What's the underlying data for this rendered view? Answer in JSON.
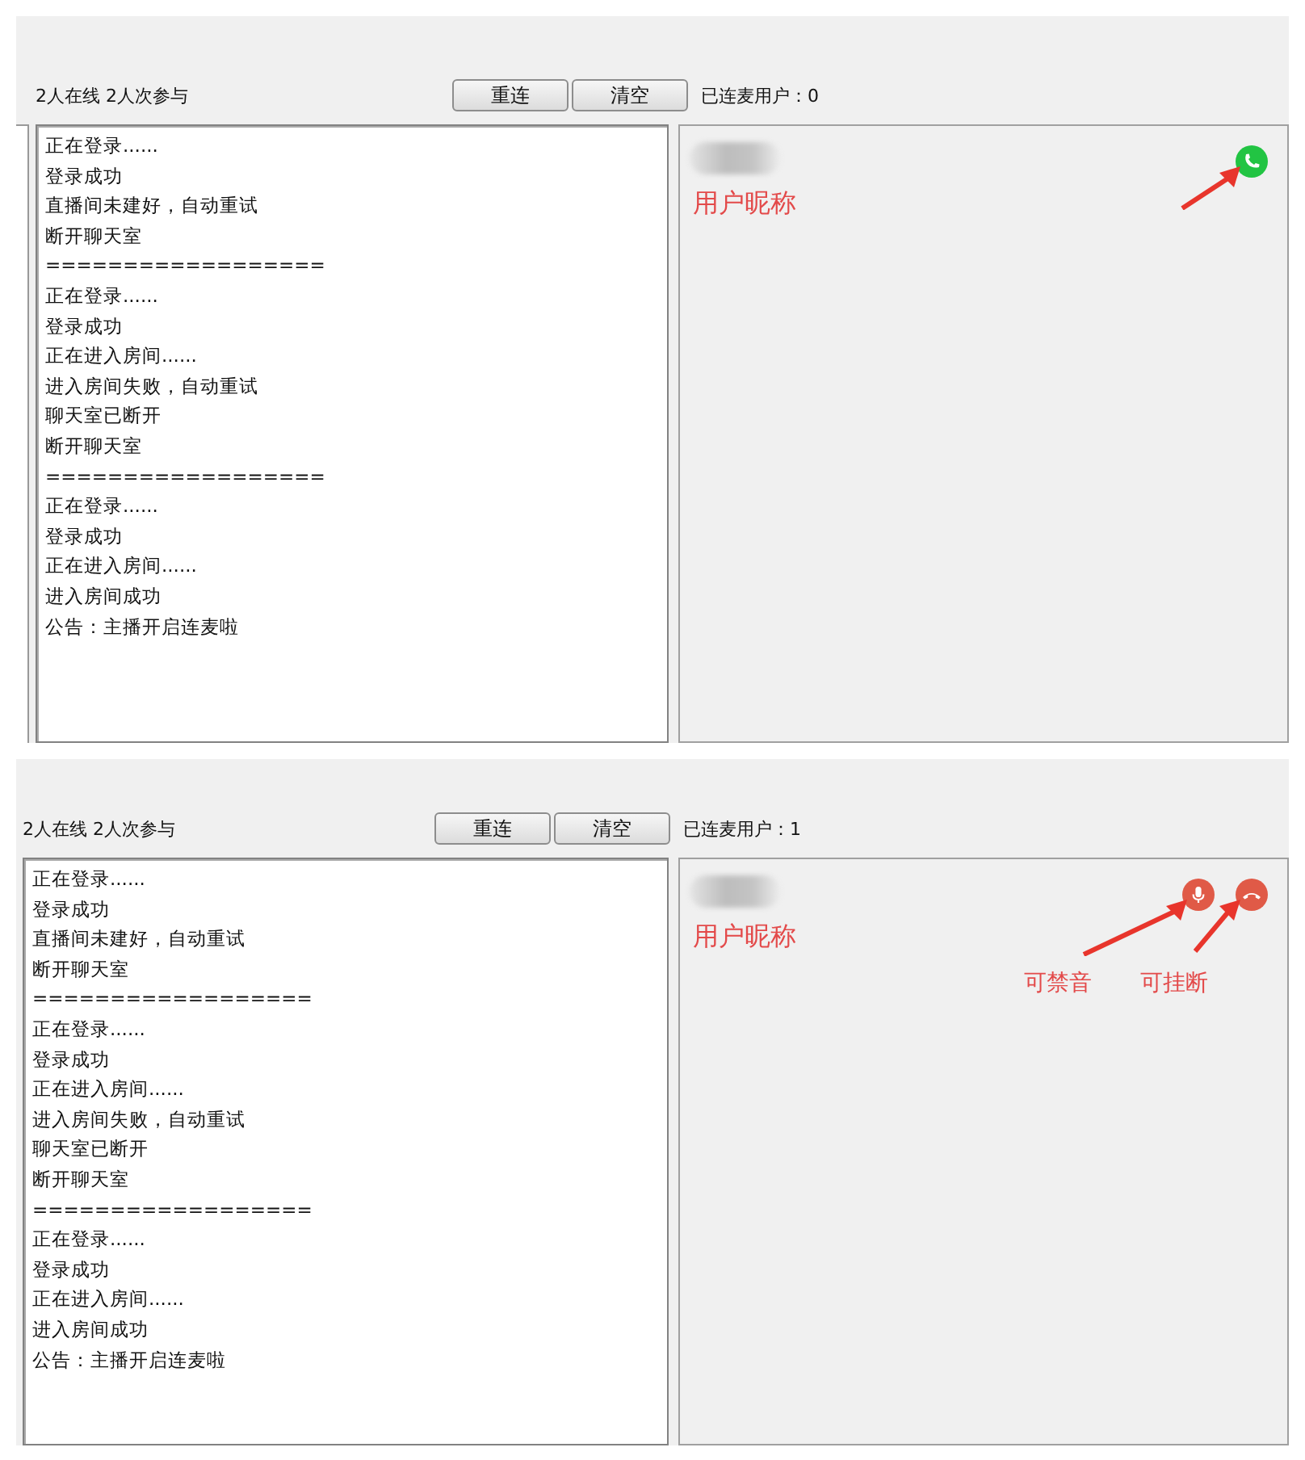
{
  "screens": [
    {
      "status": "2人在线 2人次参与",
      "side_pane": true,
      "buttons": [
        "重连",
        "清空"
      ],
      "connected_label": "已连麦用户：0",
      "log": [
        "正在登录......",
        "登录成功",
        "直播间未建好，自动重试",
        "断开聊天室",
        "==================",
        "正在登录......",
        "登录成功",
        "正在进入房间......",
        "进入房间失败，自动重试",
        "聊天室已断开",
        "断开聊天室",
        "==================",
        "正在登录......",
        "登录成功",
        "正在进入房间......",
        "进入房间成功",
        "公告：主播开启连麦啦"
      ],
      "user": {
        "nickname_note": "用户昵称",
        "actions": [
          {
            "kind": "answer"
          }
        ]
      }
    },
    {
      "status": "2人在线 2人次参与",
      "side_pane": false,
      "buttons": [
        "重连",
        "清空"
      ],
      "connected_label": "已连麦用户：1",
      "log": [
        "正在登录......",
        "登录成功",
        "直播间未建好，自动重试",
        "断开聊天室",
        "==================",
        "正在登录......",
        "登录成功",
        "正在进入房间......",
        "进入房间失败，自动重试",
        "聊天室已断开",
        "断开聊天室",
        "==================",
        "正在登录......",
        "登录成功",
        "正在进入房间......",
        "进入房间成功",
        "公告：主播开启连麦啦"
      ],
      "user": {
        "nickname_note": "用户昵称",
        "actions": [
          {
            "kind": "mute",
            "note": "可禁音"
          },
          {
            "kind": "hangup",
            "note": "可挂断"
          }
        ]
      }
    }
  ]
}
